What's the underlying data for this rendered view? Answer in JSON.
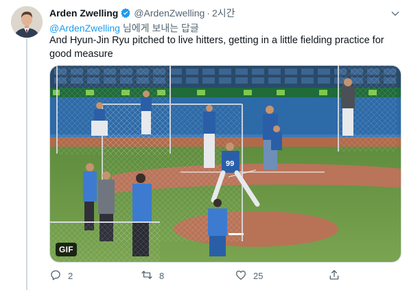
{
  "author": {
    "display_name": "Arden Zwelling",
    "handle": "@ArdenZwelling",
    "separator": "·",
    "time": "2시간",
    "verified": true
  },
  "reply_to": {
    "mention": "@ArdenZwelling",
    "suffix": "님에게 보내는 답글"
  },
  "tweet_text": "And Hyun-Jin Ryu pitched to live hitters, getting in a little fielding practice for good measure",
  "media": {
    "badge": "GIF",
    "jersey_number": "99"
  },
  "actions": {
    "reply_count": "2",
    "retweet_count": "8",
    "like_count": "25"
  },
  "icons": {
    "verified": "verified-badge-icon",
    "caret": "chevron-down-icon",
    "reply": "reply-icon",
    "retweet": "retweet-icon",
    "like": "heart-icon",
    "share": "share-icon"
  },
  "colors": {
    "accent": "#1d9bf0",
    "muted": "#536471",
    "text": "#0f1419"
  }
}
